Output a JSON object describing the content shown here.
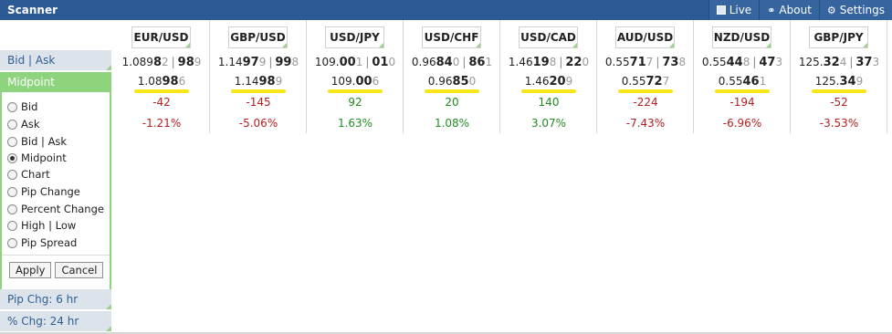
{
  "header": {
    "title": "Scanner",
    "nav": [
      {
        "label": "Live",
        "icon": "live-icon"
      },
      {
        "label": "About",
        "icon": "globe-icon"
      },
      {
        "label": "Settings",
        "icon": "gear-icon"
      }
    ]
  },
  "sidebar": {
    "bid_ask_label": "Bid | Ask",
    "active_label": "Midpoint",
    "options": [
      {
        "label": "Bid",
        "selected": false
      },
      {
        "label": "Ask",
        "selected": false
      },
      {
        "label": "Bid | Ask",
        "selected": false
      },
      {
        "label": "Midpoint",
        "selected": true
      },
      {
        "label": "Chart",
        "selected": false
      },
      {
        "label": "Pip Change",
        "selected": false
      },
      {
        "label": "Percent Change",
        "selected": false
      },
      {
        "label": "High | Low",
        "selected": false
      },
      {
        "label": "Pip Spread",
        "selected": false
      }
    ],
    "apply_label": "Apply",
    "cancel_label": "Cancel",
    "pip_chg_label": "Pip Chg: 6 hr",
    "pct_chg_label": "% Chg: 24 hr"
  },
  "pairs": [
    {
      "name": "EUR/USD",
      "bid_pre": "1.089",
      "bid_big": "8",
      "bid_small": "2",
      "ask_big": "98",
      "ask_small": "9",
      "mid_pre": "1.08",
      "mid_big": "98",
      "mid_small": "6",
      "pip": "-42",
      "pct": "-1.21%",
      "dir": "neg"
    },
    {
      "name": "GBP/USD",
      "bid_pre": "1.14",
      "bid_big": "97",
      "bid_small": "9",
      "ask_big": "99",
      "ask_small": "8",
      "mid_pre": "1.14",
      "mid_big": "98",
      "mid_small": "9",
      "pip": "-145",
      "pct": "-5.06%",
      "dir": "neg"
    },
    {
      "name": "USD/JPY",
      "bid_pre": "109.",
      "bid_big": "00",
      "bid_small": "1",
      "ask_big": "01",
      "ask_small": "0",
      "mid_pre": "109.",
      "mid_big": "00",
      "mid_small": "6",
      "pip": "92",
      "pct": "1.63%",
      "dir": "pos"
    },
    {
      "name": "USD/CHF",
      "bid_pre": "0.96",
      "bid_big": "84",
      "bid_small": "0",
      "ask_big": "86",
      "ask_small": "1",
      "mid_pre": "0.96",
      "mid_big": "85",
      "mid_small": "0",
      "pip": "20",
      "pct": "1.08%",
      "dir": "pos"
    },
    {
      "name": "USD/CAD",
      "bid_pre": "1.46",
      "bid_big": "19",
      "bid_small": "8",
      "ask_big": "22",
      "ask_small": "0",
      "mid_pre": "1.46",
      "mid_big": "20",
      "mid_small": "9",
      "pip": "140",
      "pct": "3.07%",
      "dir": "pos"
    },
    {
      "name": "AUD/USD",
      "bid_pre": "0.55",
      "bid_big": "71",
      "bid_small": "7",
      "ask_big": "73",
      "ask_small": "8",
      "mid_pre": "0.55",
      "mid_big": "72",
      "mid_small": "7",
      "pip": "-224",
      "pct": "-7.43%",
      "dir": "neg"
    },
    {
      "name": "NZD/USD",
      "bid_pre": "0.55",
      "bid_big": "44",
      "bid_small": "8",
      "ask_big": "47",
      "ask_small": "3",
      "mid_pre": "0.55",
      "mid_big": "46",
      "mid_small": "1",
      "pip": "-194",
      "pct": "-6.96%",
      "dir": "neg"
    },
    {
      "name": "GBP/JPY",
      "bid_pre": "125.",
      "bid_big": "32",
      "bid_small": "4",
      "ask_big": "37",
      "ask_small": "3",
      "mid_pre": "125.",
      "mid_big": "34",
      "mid_small": "9",
      "pip": "-52",
      "pct": "-3.53%",
      "dir": "neg"
    }
  ],
  "colors": {
    "header_bg": "#2d5a94",
    "active_green": "#8ed47f",
    "highlight_yellow": "#f6e61a",
    "negative": "#b22222",
    "positive": "#228b22"
  }
}
